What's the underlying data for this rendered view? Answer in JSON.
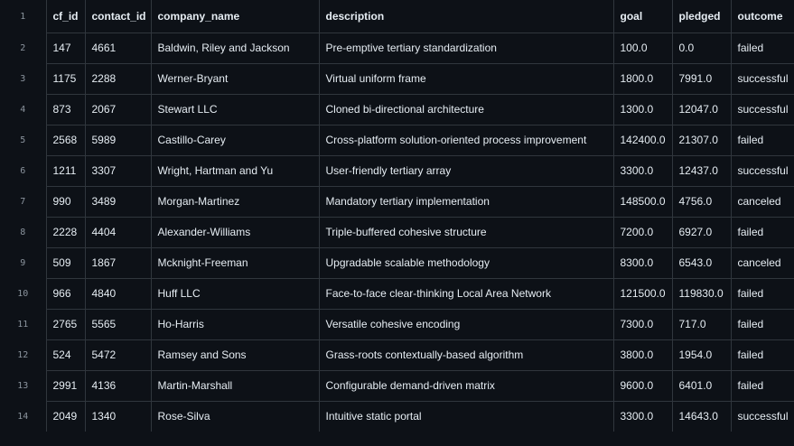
{
  "table": {
    "columns": [
      "cf_id",
      "contact_id",
      "company_name",
      "description",
      "goal",
      "pledged",
      "outcome"
    ],
    "rows": [
      {
        "line": "2",
        "cells": [
          "147",
          "4661",
          "Baldwin, Riley and Jackson",
          "Pre-emptive tertiary standardization",
          "100.0",
          "0.0",
          "failed"
        ]
      },
      {
        "line": "3",
        "cells": [
          "1175",
          "2288",
          "Werner-Bryant",
          "Virtual uniform frame",
          "1800.0",
          "7991.0",
          "successful"
        ]
      },
      {
        "line": "4",
        "cells": [
          "873",
          "2067",
          "Stewart LLC",
          "Cloned bi-directional architecture",
          "1300.0",
          "12047.0",
          "successful"
        ]
      },
      {
        "line": "5",
        "cells": [
          "2568",
          "5989",
          "Castillo-Carey",
          "Cross-platform solution-oriented process improvement",
          "142400.0",
          "21307.0",
          "failed"
        ]
      },
      {
        "line": "6",
        "cells": [
          "1211",
          "3307",
          "Wright, Hartman and Yu",
          "User-friendly tertiary array",
          "3300.0",
          "12437.0",
          "successful"
        ]
      },
      {
        "line": "7",
        "cells": [
          "990",
          "3489",
          "Morgan-Martinez",
          "Mandatory tertiary implementation",
          "148500.0",
          "4756.0",
          "canceled"
        ]
      },
      {
        "line": "8",
        "cells": [
          "2228",
          "4404",
          "Alexander-Williams",
          "Triple-buffered cohesive structure",
          "7200.0",
          "6927.0",
          "failed"
        ]
      },
      {
        "line": "9",
        "cells": [
          "509",
          "1867",
          "Mcknight-Freeman",
          "Upgradable scalable methodology",
          "8300.0",
          "6543.0",
          "canceled"
        ]
      },
      {
        "line": "10",
        "cells": [
          "966",
          "4840",
          "Huff LLC",
          "Face-to-face clear-thinking Local Area Network",
          "121500.0",
          "119830.0",
          "failed"
        ]
      },
      {
        "line": "11",
        "cells": [
          "2765",
          "5565",
          "Ho-Harris",
          "Versatile cohesive encoding",
          "7300.0",
          "717.0",
          "failed"
        ]
      },
      {
        "line": "12",
        "cells": [
          "524",
          "5472",
          "Ramsey and Sons",
          "Grass-roots contextually-based algorithm",
          "3800.0",
          "1954.0",
          "failed"
        ]
      },
      {
        "line": "13",
        "cells": [
          "2991",
          "4136",
          "Martin-Marshall",
          "Configurable demand-driven matrix",
          "9600.0",
          "6401.0",
          "failed"
        ]
      },
      {
        "line": "14",
        "cells": [
          "2049",
          "1340",
          "Rose-Silva",
          "Intuitive static portal",
          "3300.0",
          "14643.0",
          "successful"
        ]
      }
    ],
    "header_line": "1"
  }
}
